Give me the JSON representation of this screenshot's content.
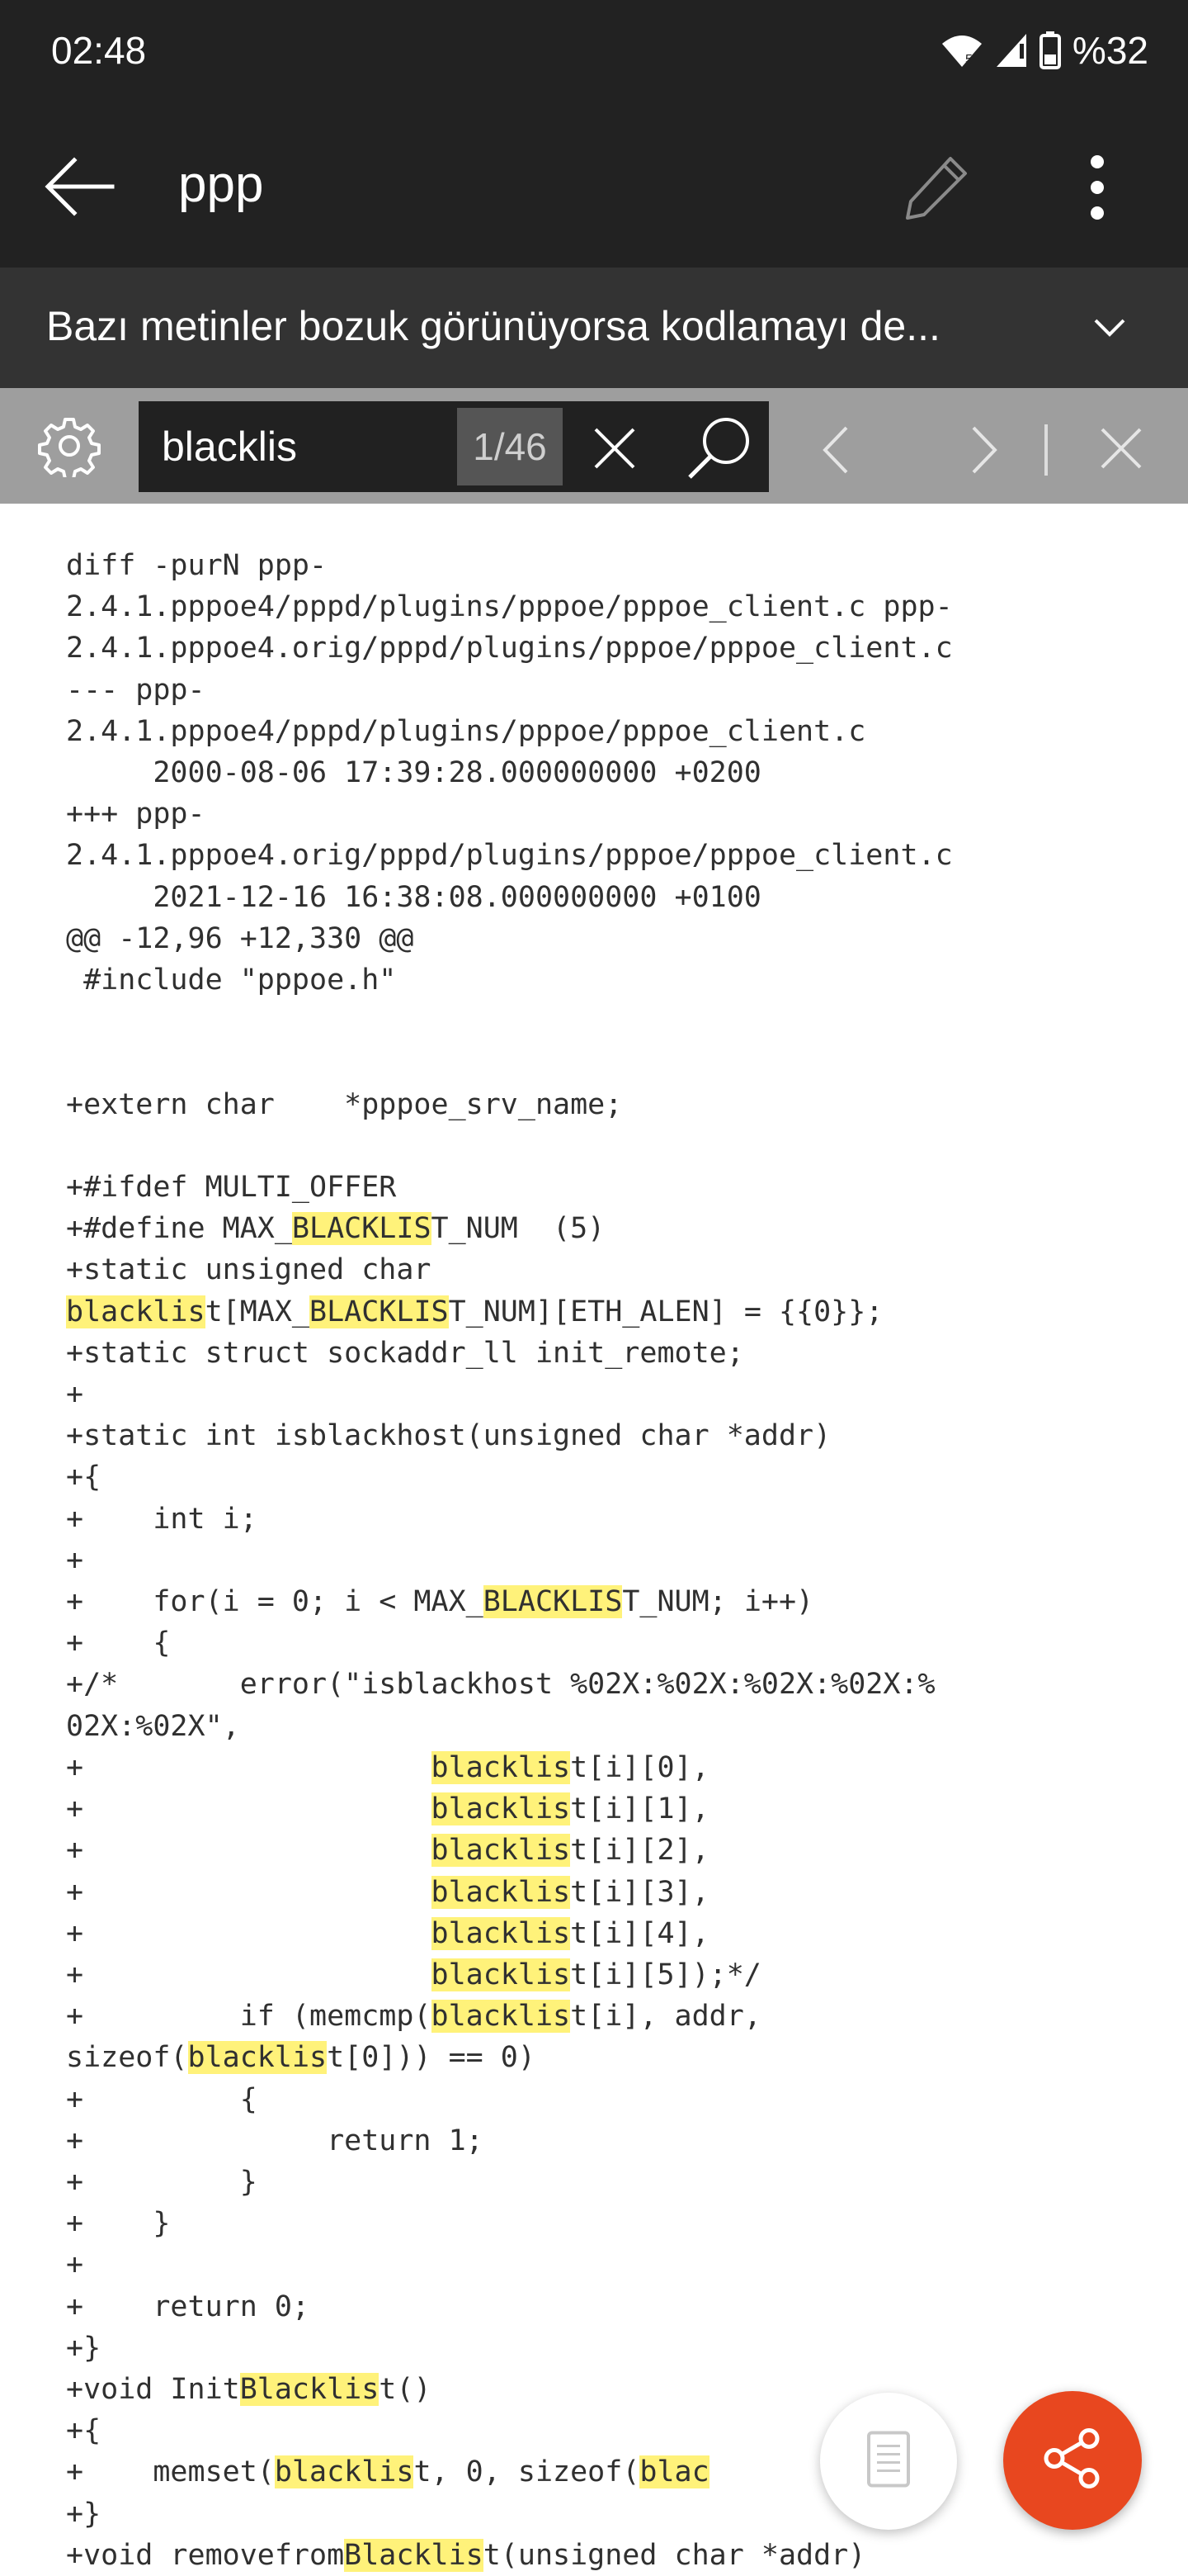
{
  "status_bar": {
    "time": "02:48",
    "battery": "%32",
    "icons": [
      "wifi-icon",
      "signal-icon",
      "battery-icon"
    ]
  },
  "app_bar": {
    "title": "ppp",
    "icons": [
      "back-arrow-icon",
      "pencil-icon",
      "more-vert-icon"
    ]
  },
  "encoding_bar": {
    "message": "Bazı metinler bozuk görünüyorsa kodlamayı de..."
  },
  "search": {
    "query": "blacklis",
    "match_counter": "1/46",
    "icons": [
      "gear-icon",
      "clear-icon",
      "search-icon",
      "chevron-left-icon",
      "chevron-right-icon",
      "close-icon"
    ]
  },
  "document": {
    "highlight_color": "#fff27a",
    "lines": [
      [
        {
          "t": "diff -purN ppp-"
        }
      ],
      [
        {
          "t": "2.4.1.pppoe4/pppd/plugins/pppoe/pppoe_client.c ppp-"
        }
      ],
      [
        {
          "t": "2.4.1.pppoe4.orig/pppd/plugins/pppoe/pppoe_client.c"
        }
      ],
      [
        {
          "t": "--- ppp-"
        }
      ],
      [
        {
          "t": "2.4.1.pppoe4/pppd/plugins/pppoe/pppoe_client.c"
        }
      ],
      [
        {
          "t": "     2000-08-06 17:39:28.000000000 +0200"
        }
      ],
      [
        {
          "t": "+++ ppp-"
        }
      ],
      [
        {
          "t": "2.4.1.pppoe4.orig/pppd/plugins/pppoe/pppoe_client.c"
        }
      ],
      [
        {
          "t": "     2021-12-16 16:38:08.000000000 +0100"
        }
      ],
      [
        {
          "t": "@@ -12,96 +12,330 @@"
        }
      ],
      [
        {
          "t": " #include \"pppoe.h\""
        }
      ],
      [
        {
          "t": ""
        }
      ],
      [
        {
          "t": ""
        }
      ],
      [
        {
          "t": "+extern char    *pppoe_srv_name;"
        }
      ],
      [
        {
          "t": ""
        }
      ],
      [
        {
          "t": "+#ifdef MULTI_OFFER"
        }
      ],
      [
        {
          "t": "+#define MAX_"
        },
        {
          "t": "BLACKLIS",
          "h": true
        },
        {
          "t": "T_NUM  (5)"
        }
      ],
      [
        {
          "t": "+static unsigned char"
        }
      ],
      [
        {
          "t": "blacklis",
          "h": true
        },
        {
          "t": "t[MAX_"
        },
        {
          "t": "BLACKLIS",
          "h": true
        },
        {
          "t": "T_NUM][ETH_ALEN] = {{0}};"
        }
      ],
      [
        {
          "t": "+static struct sockaddr_ll init_remote;"
        }
      ],
      [
        {
          "t": "+"
        }
      ],
      [
        {
          "t": "+static int isblackhost(unsigned char *addr)"
        }
      ],
      [
        {
          "t": "+{"
        }
      ],
      [
        {
          "t": "+    int i;"
        }
      ],
      [
        {
          "t": "+"
        }
      ],
      [
        {
          "t": "+    for(i = 0; i < MAX_"
        },
        {
          "t": "BLACKLIS",
          "h": true
        },
        {
          "t": "T_NUM; i++)"
        }
      ],
      [
        {
          "t": "+    {"
        }
      ],
      [
        {
          "t": "+/*       error(\"isblackhost %02X:%02X:%02X:%02X:%"
        }
      ],
      [
        {
          "t": "02X:%02X\","
        }
      ],
      [
        {
          "t": "+                    "
        },
        {
          "t": "blacklis",
          "h": true
        },
        {
          "t": "t[i][0],"
        }
      ],
      [
        {
          "t": "+                    "
        },
        {
          "t": "blacklis",
          "h": true
        },
        {
          "t": "t[i][1],"
        }
      ],
      [
        {
          "t": "+                    "
        },
        {
          "t": "blacklis",
          "h": true
        },
        {
          "t": "t[i][2],"
        }
      ],
      [
        {
          "t": "+                    "
        },
        {
          "t": "blacklis",
          "h": true
        },
        {
          "t": "t[i][3],"
        }
      ],
      [
        {
          "t": "+                    "
        },
        {
          "t": "blacklis",
          "h": true
        },
        {
          "t": "t[i][4],"
        }
      ],
      [
        {
          "t": "+                    "
        },
        {
          "t": "blacklis",
          "h": true
        },
        {
          "t": "t[i][5]);*/"
        }
      ],
      [
        {
          "t": "+         if (memcmp("
        },
        {
          "t": "blacklis",
          "h": true
        },
        {
          "t": "t[i], addr,"
        }
      ],
      [
        {
          "t": "sizeof("
        },
        {
          "t": "blacklis",
          "h": true
        },
        {
          "t": "t[0])) == 0)"
        }
      ],
      [
        {
          "t": "+         {"
        }
      ],
      [
        {
          "t": "+              return 1;"
        }
      ],
      [
        {
          "t": "+         }"
        }
      ],
      [
        {
          "t": "+    }"
        }
      ],
      [
        {
          "t": "+"
        }
      ],
      [
        {
          "t": "+    return 0;"
        }
      ],
      [
        {
          "t": "+}"
        }
      ],
      [
        {
          "t": "+void Init"
        },
        {
          "t": "Blacklis",
          "h": true
        },
        {
          "t": "t()"
        }
      ],
      [
        {
          "t": "+{"
        }
      ],
      [
        {
          "t": "+    memset("
        },
        {
          "t": "blacklis",
          "h": true
        },
        {
          "t": "t, 0, sizeof("
        },
        {
          "t": "blac",
          "h": true
        },
        {
          "t": "       );"
        }
      ],
      [
        {
          "t": "+}"
        }
      ],
      [
        {
          "t": "+void removefrom"
        },
        {
          "t": "Blacklis",
          "h": true
        },
        {
          "t": "t(unsigned char *addr)"
        }
      ]
    ]
  },
  "fabs": {
    "icons": [
      "document-icon",
      "share-icon"
    ],
    "share_color": "#e8471f"
  }
}
